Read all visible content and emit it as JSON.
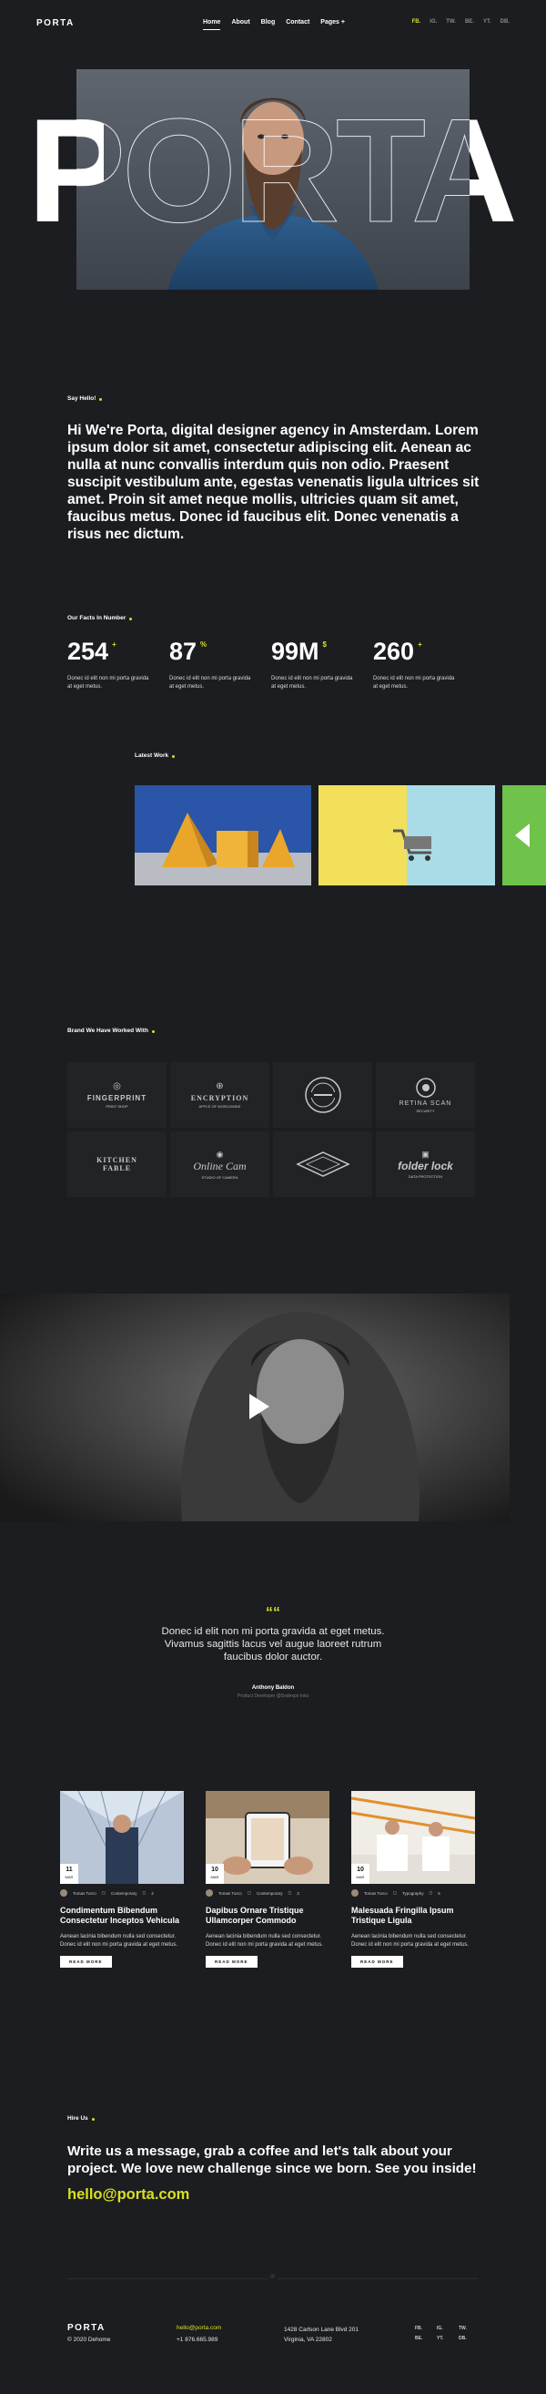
{
  "header": {
    "logo": "PORTA",
    "nav": [
      "Home",
      "About",
      "Blog",
      "Contact",
      "Pages +"
    ],
    "social": [
      "FB.",
      "IG.",
      "TW.",
      "BE.",
      "YT.",
      "DB."
    ]
  },
  "hero": {
    "big_text": "PORTA"
  },
  "intro": {
    "kicker": "Say Hello!",
    "text": "Hi We're Porta, digital designer agency in Amsterdam. Lorem ipsum dolor sit amet, consectetur adipiscing elit. Aenean ac nulla at nunc convallis interdum quis non odio. Praesent suscipit vestibulum ante, egestas venenatis ligula ultrices sit amet. Proin sit amet neque mollis, ultricies quam sit amet, faucibus metus. Donec id faucibus elit. Donec venenatis a risus nec dictum."
  },
  "facts": {
    "kicker": "Our Facts In Number",
    "items": [
      {
        "num": "254",
        "suffix": "+",
        "desc": "Donec id elit non mi porta gravida at eget metus."
      },
      {
        "num": "87",
        "suffix": "%",
        "desc": "Donec id elit non mi porta gravida at eget metus."
      },
      {
        "num": "99M",
        "suffix": "$",
        "desc": "Donec id elit non mi porta gravida at eget metus."
      },
      {
        "num": "260",
        "suffix": "+",
        "desc": "Donec id elit non mi porta gravida at eget metus."
      }
    ]
  },
  "work": {
    "kicker": "Latest Work"
  },
  "brands": {
    "kicker": "Brand We Have Worked With",
    "items": [
      {
        "name": "FINGERPRINT",
        "sub": "PRINT SHOP"
      },
      {
        "name": "ENCRYPTION",
        "sub": "APPLE OF WORLDWIDE"
      },
      {
        "name": "",
        "sub": ""
      },
      {
        "name": "RETINA SCAN",
        "sub": "SECURITY"
      },
      {
        "name": "KITCHEN FABLE",
        "sub": ""
      },
      {
        "name": "Online Cam",
        "sub": "STUDIO OF CAMERA"
      },
      {
        "name": "",
        "sub": ""
      },
      {
        "name": "folder lock",
        "sub": "DATA PROTECTION"
      }
    ]
  },
  "testimonial": {
    "quote_mark": "““",
    "quote": "Donec id elit non mi porta gravida at eget metus. Vivamus sagittis lacus vel augue laoreet rutrum faucibus dolor auctor.",
    "author": "Anthony Baldon",
    "role": "Product Developer @Sodexpo Inks"
  },
  "blog": {
    "posts": [
      {
        "day": "11",
        "month": "MAR",
        "author": "Tomas Turco",
        "category": "Contemporary",
        "comments": "4",
        "title": "Condimentum Bibendum Consectetur Inceptos Vehicula",
        "excerpt": "Aenean lacinia bibendum nulla sed consectetur. Donec id elit non mi porta gravida at eget metus.",
        "cta": "READ MORE"
      },
      {
        "day": "10",
        "month": "MAR",
        "author": "Tomas Turco",
        "category": "Contemporary",
        "comments": "3",
        "title": "Dapibus Ornare Tristique Ullamcorper Commodo",
        "excerpt": "Aenean lacinia bibendum nulla sed consectetur. Donec id elit non mi porta gravida at eget metus.",
        "cta": "READ MORE"
      },
      {
        "day": "10",
        "month": "MAR",
        "author": "Tomas Turco",
        "category": "Typography",
        "comments": "5",
        "title": "Malesuada Fringilla Ipsum Tristique Ligula",
        "excerpt": "Aenean lacinia bibendum nulla sed consectetur. Donec id elit non mi porta gravida at eget metus.",
        "cta": "READ MORE"
      }
    ]
  },
  "hire": {
    "kicker": "Hire Us",
    "text": "Write us a message, grab a coffee and let's talk about your project. We love new challenge since we born. See you inside!",
    "email": "hello@porta.com"
  },
  "footer": {
    "divider_mark": "///",
    "logo": "PORTA",
    "copyright": "© 2020 Dehome",
    "email": "hello@porta.com",
    "phone": "+1 876.665.989",
    "address_1": "1428 Carlson Lane Blvd 201",
    "address_2": "Virginia, VA 22802",
    "social": [
      "FB.",
      "IG.",
      "TW.",
      "BE.",
      "YT.",
      "DB."
    ]
  },
  "colors": {
    "accent": "#d7e021",
    "background": "#1c1d20"
  }
}
